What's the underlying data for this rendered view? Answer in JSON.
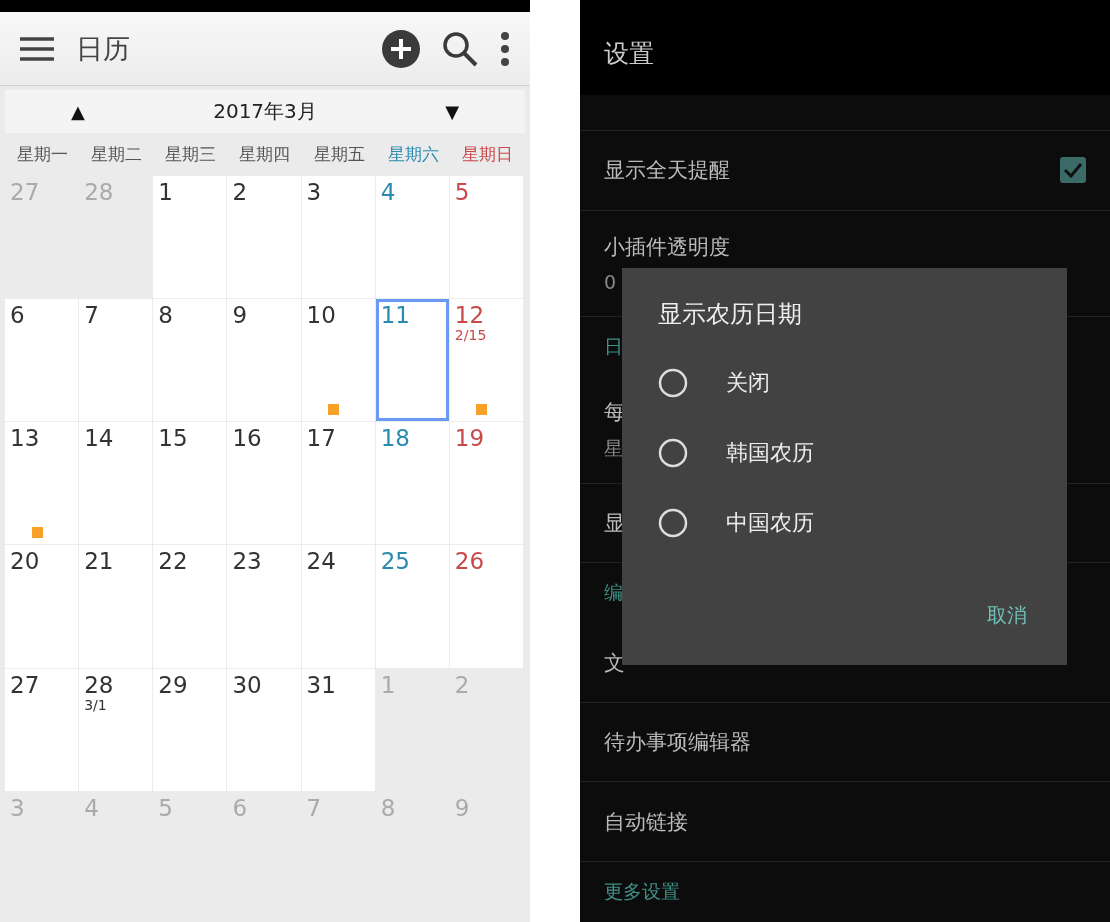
{
  "calendar_app": {
    "toolbar": {
      "title": "日历"
    },
    "month_nav": {
      "prev": "▲",
      "label": "2017年3月",
      "next": "▼"
    },
    "weekdays": [
      {
        "label": "星期一",
        "kind": "weekday"
      },
      {
        "label": "星期二",
        "kind": "weekday"
      },
      {
        "label": "星期三",
        "kind": "weekday"
      },
      {
        "label": "星期四",
        "kind": "weekday"
      },
      {
        "label": "星期五",
        "kind": "weekday"
      },
      {
        "label": "星期六",
        "kind": "saturday"
      },
      {
        "label": "星期日",
        "kind": "sunday"
      }
    ],
    "days": [
      {
        "day": "27",
        "in_month": false,
        "event": false,
        "selected": false
      },
      {
        "day": "28",
        "in_month": false,
        "event": false,
        "selected": false
      },
      {
        "day": "1",
        "in_month": true,
        "event": false,
        "selected": false
      },
      {
        "day": "2",
        "in_month": true,
        "event": false,
        "selected": false
      },
      {
        "day": "3",
        "in_month": true,
        "event": false,
        "selected": false
      },
      {
        "day": "4",
        "in_month": true,
        "event": false,
        "selected": false
      },
      {
        "day": "5",
        "in_month": true,
        "event": false,
        "selected": false
      },
      {
        "day": "6",
        "in_month": true,
        "event": false,
        "selected": false
      },
      {
        "day": "7",
        "in_month": true,
        "event": false,
        "selected": false
      },
      {
        "day": "8",
        "in_month": true,
        "event": false,
        "selected": false
      },
      {
        "day": "9",
        "in_month": true,
        "event": false,
        "selected": false
      },
      {
        "day": "10",
        "in_month": true,
        "event": true,
        "selected": false
      },
      {
        "day": "11",
        "in_month": true,
        "event": false,
        "selected": true
      },
      {
        "day": "12",
        "lunar": "2/15",
        "in_month": true,
        "event": true,
        "selected": false
      },
      {
        "day": "13",
        "in_month": true,
        "event": true,
        "selected": false
      },
      {
        "day": "14",
        "in_month": true,
        "event": false,
        "selected": false
      },
      {
        "day": "15",
        "in_month": true,
        "event": false,
        "selected": false
      },
      {
        "day": "16",
        "in_month": true,
        "event": false,
        "selected": false
      },
      {
        "day": "17",
        "in_month": true,
        "event": false,
        "selected": false
      },
      {
        "day": "18",
        "in_month": true,
        "event": false,
        "selected": false
      },
      {
        "day": "19",
        "in_month": true,
        "event": false,
        "selected": false
      },
      {
        "day": "20",
        "in_month": true,
        "event": false,
        "selected": false
      },
      {
        "day": "21",
        "in_month": true,
        "event": false,
        "selected": false
      },
      {
        "day": "22",
        "in_month": true,
        "event": false,
        "selected": false
      },
      {
        "day": "23",
        "in_month": true,
        "event": false,
        "selected": false
      },
      {
        "day": "24",
        "in_month": true,
        "event": false,
        "selected": false
      },
      {
        "day": "25",
        "in_month": true,
        "event": false,
        "selected": false
      },
      {
        "day": "26",
        "in_month": true,
        "event": false,
        "selected": false
      },
      {
        "day": "27",
        "in_month": true,
        "event": false,
        "selected": false
      },
      {
        "day": "28",
        "lunar": "3/1",
        "in_month": true,
        "event": false,
        "selected": false
      },
      {
        "day": "29",
        "in_month": true,
        "event": false,
        "selected": false
      },
      {
        "day": "30",
        "in_month": true,
        "event": false,
        "selected": false
      },
      {
        "day": "31",
        "in_month": true,
        "event": false,
        "selected": false
      },
      {
        "day": "1",
        "in_month": false,
        "event": false,
        "selected": false
      },
      {
        "day": "2",
        "in_month": false,
        "event": false,
        "selected": false
      },
      {
        "day": "3",
        "in_month": false,
        "event": false,
        "selected": false
      },
      {
        "day": "4",
        "in_month": false,
        "event": false,
        "selected": false
      },
      {
        "day": "5",
        "in_month": false,
        "event": false,
        "selected": false
      },
      {
        "day": "6",
        "in_month": false,
        "event": false,
        "selected": false
      },
      {
        "day": "7",
        "in_month": false,
        "event": false,
        "selected": false
      },
      {
        "day": "8",
        "in_month": false,
        "event": false,
        "selected": false
      },
      {
        "day": "9",
        "in_month": false,
        "event": false,
        "selected": false
      }
    ]
  },
  "settings_app": {
    "header": {
      "title": "设置"
    },
    "items": [
      {
        "kind": "item",
        "title": "显示全天提醒",
        "checked": true
      },
      {
        "kind": "item",
        "title": "小插件透明度",
        "subtitle": "0"
      },
      {
        "kind": "header",
        "title": "日"
      },
      {
        "kind": "item",
        "title": "每",
        "subtitle": "星"
      },
      {
        "kind": "item",
        "title": "显"
      },
      {
        "kind": "header",
        "title": "编"
      },
      {
        "kind": "item",
        "title": "文"
      },
      {
        "kind": "item",
        "title": "待办事项编辑器"
      },
      {
        "kind": "item",
        "title": "自动链接"
      },
      {
        "kind": "header",
        "title": "更多设置"
      }
    ],
    "dialog": {
      "title": "显示农历日期",
      "options": [
        {
          "label": "关闭",
          "selected": false
        },
        {
          "label": "韩国农历",
          "selected": false
        },
        {
          "label": "中国农历",
          "selected": false
        }
      ],
      "cancel": "取消"
    }
  }
}
